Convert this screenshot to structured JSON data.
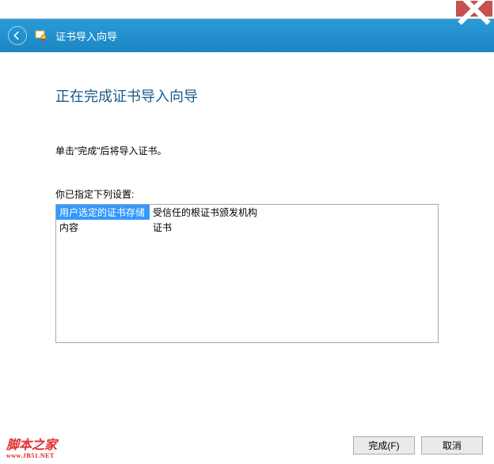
{
  "window": {
    "title": "证书导入向导"
  },
  "main": {
    "heading": "正在完成证书导入向导",
    "instruction": "单击\"完成\"后将导入证书。",
    "settings_label": "你已指定下列设置:",
    "rows": [
      {
        "key": "用户选定的证书存储",
        "value": "受信任的根证书颁发机构",
        "selected": true
      },
      {
        "key": "内容",
        "value": "证书",
        "selected": false
      }
    ]
  },
  "footer": {
    "finish": "完成(F)",
    "cancel": "取消"
  },
  "watermark": {
    "text": "脚本之家",
    "url": "www.JB51.NET"
  }
}
